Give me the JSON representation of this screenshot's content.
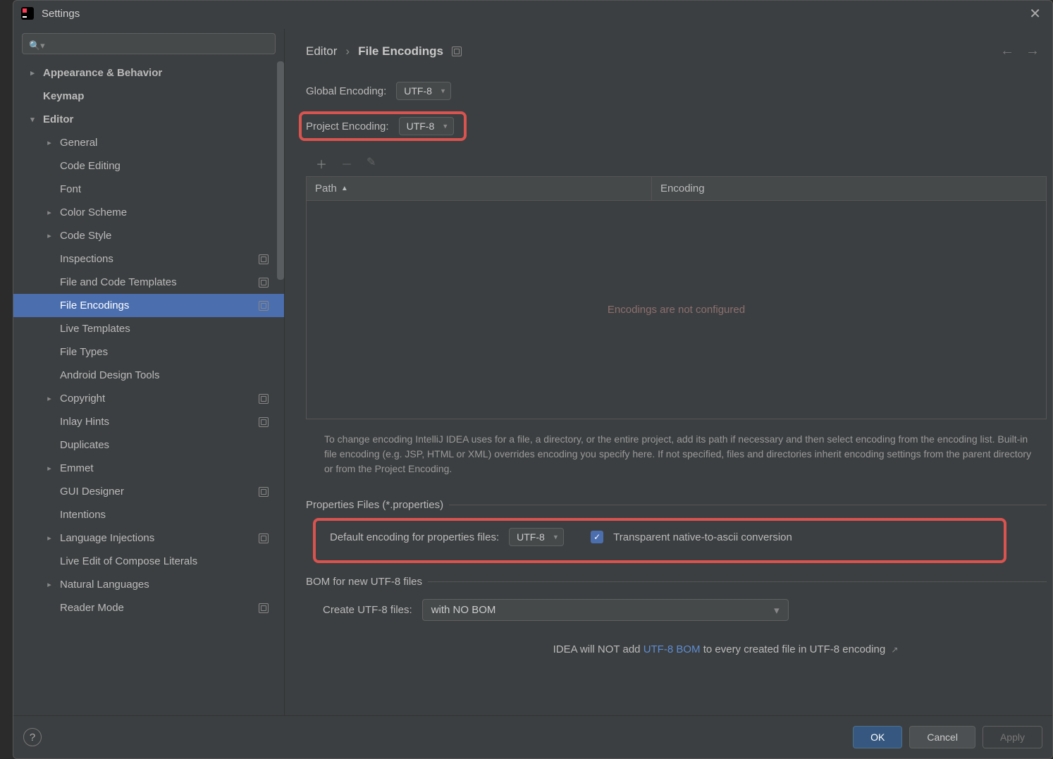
{
  "window": {
    "title": "Settings"
  },
  "search": {
    "placeholder": ""
  },
  "sidebar": {
    "items": [
      {
        "label": "Appearance & Behavior",
        "indent": 0,
        "chev": "right",
        "bold": true
      },
      {
        "label": "Keymap",
        "indent": 0,
        "chev": "none",
        "bold": true
      },
      {
        "label": "Editor",
        "indent": 0,
        "chev": "down",
        "bold": true
      },
      {
        "label": "General",
        "indent": 1,
        "chev": "right"
      },
      {
        "label": "Code Editing",
        "indent": 1,
        "chev": "none"
      },
      {
        "label": "Font",
        "indent": 1,
        "chev": "none"
      },
      {
        "label": "Color Scheme",
        "indent": 1,
        "chev": "right"
      },
      {
        "label": "Code Style",
        "indent": 1,
        "chev": "right"
      },
      {
        "label": "Inspections",
        "indent": 1,
        "chev": "none",
        "cfg": true
      },
      {
        "label": "File and Code Templates",
        "indent": 1,
        "chev": "none",
        "cfg": true
      },
      {
        "label": "File Encodings",
        "indent": 1,
        "chev": "none",
        "cfg": true,
        "selected": true
      },
      {
        "label": "Live Templates",
        "indent": 1,
        "chev": "none"
      },
      {
        "label": "File Types",
        "indent": 1,
        "chev": "none"
      },
      {
        "label": "Android Design Tools",
        "indent": 1,
        "chev": "none"
      },
      {
        "label": "Copyright",
        "indent": 1,
        "chev": "right",
        "cfg": true
      },
      {
        "label": "Inlay Hints",
        "indent": 1,
        "chev": "none",
        "cfg": true
      },
      {
        "label": "Duplicates",
        "indent": 1,
        "chev": "none"
      },
      {
        "label": "Emmet",
        "indent": 1,
        "chev": "right"
      },
      {
        "label": "GUI Designer",
        "indent": 1,
        "chev": "none",
        "cfg": true
      },
      {
        "label": "Intentions",
        "indent": 1,
        "chev": "none"
      },
      {
        "label": "Language Injections",
        "indent": 1,
        "chev": "right",
        "cfg": true
      },
      {
        "label": "Live Edit of Compose Literals",
        "indent": 1,
        "chev": "none"
      },
      {
        "label": "Natural Languages",
        "indent": 1,
        "chev": "right"
      },
      {
        "label": "Reader Mode",
        "indent": 1,
        "chev": "none",
        "cfg": true
      }
    ]
  },
  "breadcrumb": {
    "parent": "Editor",
    "sep": "›",
    "current": "File Encodings"
  },
  "global_encoding": {
    "label": "Global Encoding:",
    "value": "UTF-8"
  },
  "project_encoding": {
    "label": "Project Encoding:",
    "value": "UTF-8"
  },
  "table": {
    "col_path": "Path",
    "col_encoding": "Encoding",
    "empty_text": "Encodings are not configured"
  },
  "help_paragraph": "To change encoding IntelliJ IDEA uses for a file, a directory, or the entire project, add its path if necessary and then select encoding from the encoding list. Built-in file encoding (e.g. JSP, HTML or XML) overrides encoding you specify here. If not specified, files and directories inherit encoding settings from the parent directory or from the Project Encoding.",
  "properties_section": {
    "title": "Properties Files (*.properties)",
    "default_label": "Default encoding for properties files:",
    "default_value": "UTF-8",
    "checkbox_label": "Transparent native-to-ascii conversion"
  },
  "bom_section": {
    "title": "BOM for new UTF-8 files",
    "create_label": "Create UTF-8 files:",
    "create_value": "with NO BOM",
    "note_pre": "IDEA will NOT add",
    "note_link": "UTF-8 BOM",
    "note_post": "to every created file in UTF-8 encoding"
  },
  "footer": {
    "ok": "OK",
    "cancel": "Cancel",
    "apply": "Apply"
  }
}
